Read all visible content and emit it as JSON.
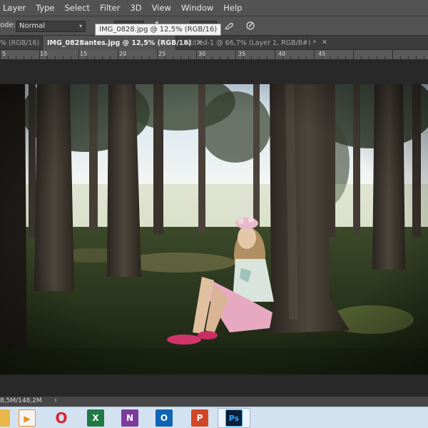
{
  "menubar": {
    "items": [
      "Layer",
      "Type",
      "Select",
      "Filter",
      "3D",
      "View",
      "Window",
      "Help"
    ]
  },
  "options": {
    "mode_label": "ode:",
    "mode_value": "Normal"
  },
  "tooltip": {
    "text": "IMG_0828.jpg @ 12,5% (RGB/16)"
  },
  "tabs": [
    {
      "label": "% (RGB/16)",
      "active": false
    },
    {
      "label": "IMG_0828antes.jpg @ 12,5% (RGB/16)",
      "active": true
    },
    {
      "label": "Untitled-1 @ 66,7% (Layer 1, RGB/8#) *",
      "active": false
    }
  ],
  "ruler": {
    "labels": [
      "5",
      "10",
      "15",
      "20",
      "25",
      "30",
      "35",
      "40",
      "45"
    ]
  },
  "status": {
    "doc_size": "8,5M/148,2M",
    "arrow": "›"
  },
  "taskbar": {
    "apps": [
      {
        "icon": "explorer-folder-icon",
        "glyph": "",
        "color": "#e9b84a"
      },
      {
        "icon": "media-player-icon",
        "glyph": "▶",
        "color": "#f08c1c"
      },
      {
        "icon": "opera-icon",
        "glyph": "O",
        "color": "#e0222e"
      },
      {
        "icon": "excel-icon",
        "glyph": "X",
        "color": "#1f7a45"
      },
      {
        "icon": "onenote-icon",
        "glyph": "N",
        "color": "#7c3a9c"
      },
      {
        "icon": "outlook-icon",
        "glyph": "O",
        "color": "#0f64b4"
      },
      {
        "icon": "powerpoint-icon",
        "glyph": "P",
        "color": "#d24726"
      },
      {
        "icon": "photoshop-icon",
        "glyph": "Ps",
        "color": "#0b1f35"
      }
    ]
  },
  "colors": {
    "accent_ps": "#31a8ff"
  }
}
